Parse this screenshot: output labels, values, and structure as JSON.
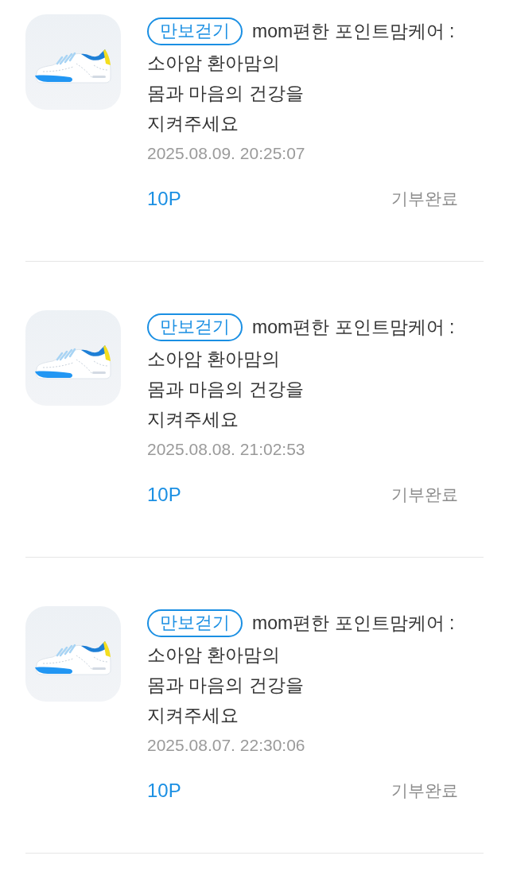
{
  "donations": [
    {
      "tag": "만보걷기",
      "title": "mom편한 포인트맘케어 :\n소아암 환아맘의\n몸과 마음의 건강을\n지켜주세요",
      "date": "2025.08.09. 20:25:07",
      "points": "10P",
      "status": "기부완료"
    },
    {
      "tag": "만보걷기",
      "title": "mom편한 포인트맘케어 :\n소아암 환아맘의\n몸과 마음의 건강을\n지켜주세요",
      "date": "2025.08.08. 21:02:53",
      "points": "10P",
      "status": "기부완료"
    },
    {
      "tag": "만보걷기",
      "title": "mom편한 포인트맘케어 :\n소아암 환아맘의\n몸과 마음의 건강을\n지켜주세요",
      "date": "2025.08.07. 22:30:06",
      "points": "10P",
      "status": "기부완료"
    }
  ]
}
